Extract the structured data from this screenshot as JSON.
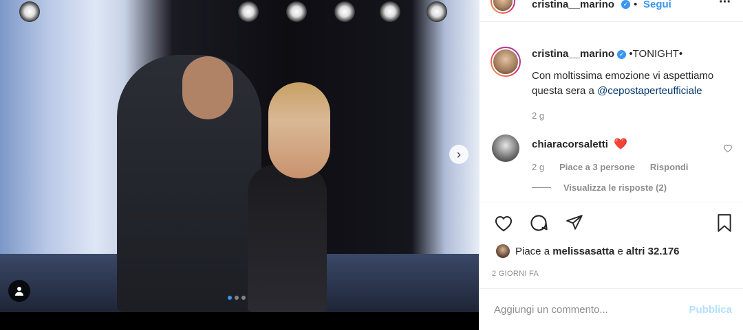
{
  "header": {
    "username": "cristina__marino",
    "follow_label": "Segui",
    "separator": "•",
    "more_icon": "more-horizontal-icon"
  },
  "caption": {
    "username": "cristina__marino",
    "title": "•TONIGHT•",
    "text_line1": "Con moltissima emozione vi aspettiamo",
    "text_line2_prefix": "questa sera a ",
    "mention": "@cepostaperteufficiale",
    "time": "2 g"
  },
  "comment": {
    "username": "chiaracorsaletti",
    "text": "❤️",
    "time": "2 g",
    "likes": "Piace a 3 persone",
    "reply_label": "Rispondi",
    "view_replies": "Visualizza le risposte (2)"
  },
  "likes": {
    "prefix": "Piace a",
    "user": "melissasatta",
    "conj": "e",
    "others": "altri 32.176"
  },
  "timestamp": "2 GIORNI FA",
  "add_comment": {
    "placeholder": "Aggiungi un commento...",
    "publish_label": "Pubblica"
  },
  "carousel": {
    "slide_count": 3,
    "active_index": 0
  },
  "colors": {
    "accent": "#3897f0",
    "publish_disabled": "#b2dffc",
    "heart": "#ed4956"
  }
}
